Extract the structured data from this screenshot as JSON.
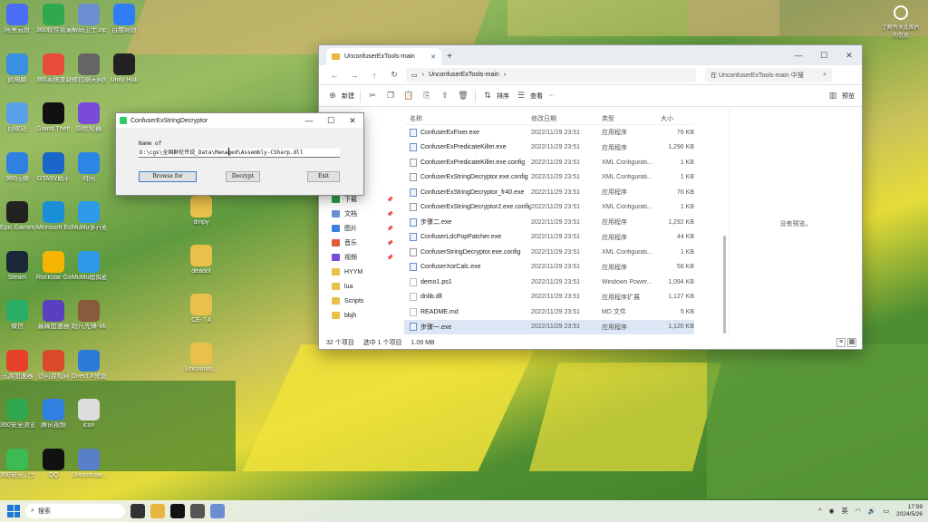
{
  "desktop": {
    "icons": [
      {
        "label": "阿里云盘",
        "color": "#4a6cf7"
      },
      {
        "label": "360软件管家",
        "color": "#2fa84f"
      },
      {
        "label": "解码卫士.zip",
        "color": "#6b8fd1"
      },
      {
        "label": "百度网盘",
        "color": "#2f7ef7"
      },
      {
        "label": "此电脑",
        "color": "#3b8fe0"
      },
      {
        "label": "360系统重装大师",
        "color": "#e84c3d"
      },
      {
        "label": "修拉聊天网络",
        "color": "#666"
      },
      {
        "label": "Unity Hub",
        "color": "#222"
      },
      {
        "label": "回收站",
        "color": "#5aa0e8"
      },
      {
        "label": "Grand Theft Auto V",
        "color": "#111"
      },
      {
        "label": "GI优化器",
        "color": "#7a4ad8"
      },
      {
        "label": "360压缩",
        "color": "#2f80e0"
      },
      {
        "label": "GTA5V助手",
        "color": "#1a66c9"
      },
      {
        "label": "时间",
        "color": "#2c86e6"
      },
      {
        "label": "Epic Games Launcher",
        "color": "#222"
      },
      {
        "label": "Microsoft Edge",
        "color": "#1a8fd8"
      },
      {
        "label": "MuMu多开器",
        "color": "#2d9be8"
      },
      {
        "label": "dmpy",
        "color": "#e9c04a"
      },
      {
        "label": "Steam",
        "color": "#1b2838"
      },
      {
        "label": "Rockstar Games...",
        "color": "#f4b400"
      },
      {
        "label": "MuMu模拟器",
        "color": "#2d9be8"
      },
      {
        "label": "deadot",
        "color": "#e9c04a"
      },
      {
        "label": "微信",
        "color": "#2aae67"
      },
      {
        "label": "暴躁加速器",
        "color": "#5a3fc0"
      },
      {
        "label": "超凡先锋-MuMu模...",
        "color": "#8a5a3c"
      },
      {
        "label": "CE-7.4",
        "color": "#e9c04a"
      },
      {
        "label": "迅游加速器",
        "color": "#e8412a"
      },
      {
        "label": "访问游戏网",
        "color": "#d84a2a"
      },
      {
        "label": "Direct X修复工具",
        "color": "#2a7ad8"
      },
      {
        "label": "Unconfus...",
        "color": "#e9c04a"
      },
      {
        "label": "360安全浏览器",
        "color": "#2fa84f"
      },
      {
        "label": "腾讯视频",
        "color": "#2f80e0"
      },
      {
        "label": "icon",
        "color": "#ddd"
      },
      {
        "label": "360安全卫士",
        "color": "#3cba54"
      },
      {
        "label": "QQ",
        "color": "#111"
      },
      {
        "label": "Unconfuse...",
        "color": "#5a7fc9"
      }
    ],
    "top_right": "了解有关此图片的信息"
  },
  "dialog": {
    "title": "ConfuserExStringDecryptor",
    "field_label": "Name of",
    "path": "D:\\cgs\\全国群伦传说_Data\\Managed\\Assembly-CSharp.dll",
    "browse_label": "Browse for",
    "decrypt_label": "Decrypt",
    "exit_label": "Exit"
  },
  "explorer": {
    "tab_title": "UnconfuserExTools-main",
    "address": "UnconfuserExTools-main",
    "search_placeholder": "在 UnconfuserExTools-main 中搜",
    "toolbar": {
      "new": "新建",
      "sort": "排序",
      "view": "查看",
      "more": "···",
      "preview": "预览"
    },
    "sidebar": [
      {
        "label": "下载",
        "color": "#2f9a4f"
      },
      {
        "label": "文档",
        "color": "#6b8fd1"
      },
      {
        "label": "图片",
        "color": "#3b7fe0"
      },
      {
        "label": "音乐",
        "color": "#e05a3b"
      },
      {
        "label": "视频",
        "color": "#7a4ad8"
      },
      {
        "label": "HYYM",
        "color": "#e9c04a"
      },
      {
        "label": "lua",
        "color": "#e9c04a"
      },
      {
        "label": "Scripts",
        "color": "#e9c04a"
      },
      {
        "label": "bbjh",
        "color": "#e9c04a"
      }
    ],
    "columns": [
      "名称",
      "修改日期",
      "类型",
      "大小"
    ],
    "files": [
      {
        "name": "ConfuserExFixer.exe",
        "date": "2022/11/29 23:51",
        "type": "应用程序",
        "size": "76 KB",
        "kind": "exe"
      },
      {
        "name": "ConfuserExPredicateKiller.exe",
        "date": "2022/11/29 23:51",
        "type": "应用程序",
        "size": "1,296 KB",
        "kind": "exe"
      },
      {
        "name": "ConfuserExPredicateKiller.exe.config",
        "date": "2022/11/29 23:51",
        "type": "XML Configurati...",
        "size": "1 KB",
        "kind": "cfg"
      },
      {
        "name": "ConfuserExStringDecryptor.exe.config",
        "date": "2022/11/29 23:51",
        "type": "XML Configurati...",
        "size": "1 KB",
        "kind": "cfg"
      },
      {
        "name": "ConfuserExStringDecryptor_fr40.exe",
        "date": "2022/11/29 23:51",
        "type": "应用程序",
        "size": "76 KB",
        "kind": "exe"
      },
      {
        "name": "ConfuserExStringDecryptor2.exe.config",
        "date": "2022/11/29 23:51",
        "type": "XML Configurati...",
        "size": "1 KB",
        "kind": "cfg"
      },
      {
        "name": "步骤二.exe",
        "date": "2022/11/29 23:51",
        "type": "应用程序",
        "size": "1,292 KB",
        "kind": "exe"
      },
      {
        "name": "ConfuserLdcPopPatcher.exe",
        "date": "2022/11/29 23:51",
        "type": "应用程序",
        "size": "44 KB",
        "kind": "exe"
      },
      {
        "name": "ConfuserStringDecryptor.exe.config",
        "date": "2022/11/29 23:51",
        "type": "XML Configurati...",
        "size": "1 KB",
        "kind": "cfg"
      },
      {
        "name": "ConfuserXorCalc.exe",
        "date": "2022/11/29 23:51",
        "type": "应用程序",
        "size": "56 KB",
        "kind": "exe"
      },
      {
        "name": "demo1.ps1",
        "date": "2022/11/29 23:51",
        "type": "Windows Power...",
        "size": "1,094 KB",
        "kind": "doc"
      },
      {
        "name": "dnlib.dll",
        "date": "2022/11/29 23:51",
        "type": "应用程序扩展",
        "size": "1,127 KB",
        "kind": "doc"
      },
      {
        "name": "README.md",
        "date": "2022/11/29 23:51",
        "type": "MD 文件",
        "size": "5 KB",
        "kind": "doc"
      },
      {
        "name": "步骤一.exe",
        "date": "2022/11/29 23:51",
        "type": "应用程序",
        "size": "1,120 KB",
        "kind": "exe",
        "selected": true
      }
    ],
    "preview_text": "没有预览。",
    "status": {
      "count": "32 个项目",
      "selected": "选中 1 个项目",
      "size": "1.09 MB"
    }
  },
  "taskbar": {
    "search": "搜索",
    "ime": "英",
    "time": "17:59",
    "date": "2024/5/26"
  }
}
